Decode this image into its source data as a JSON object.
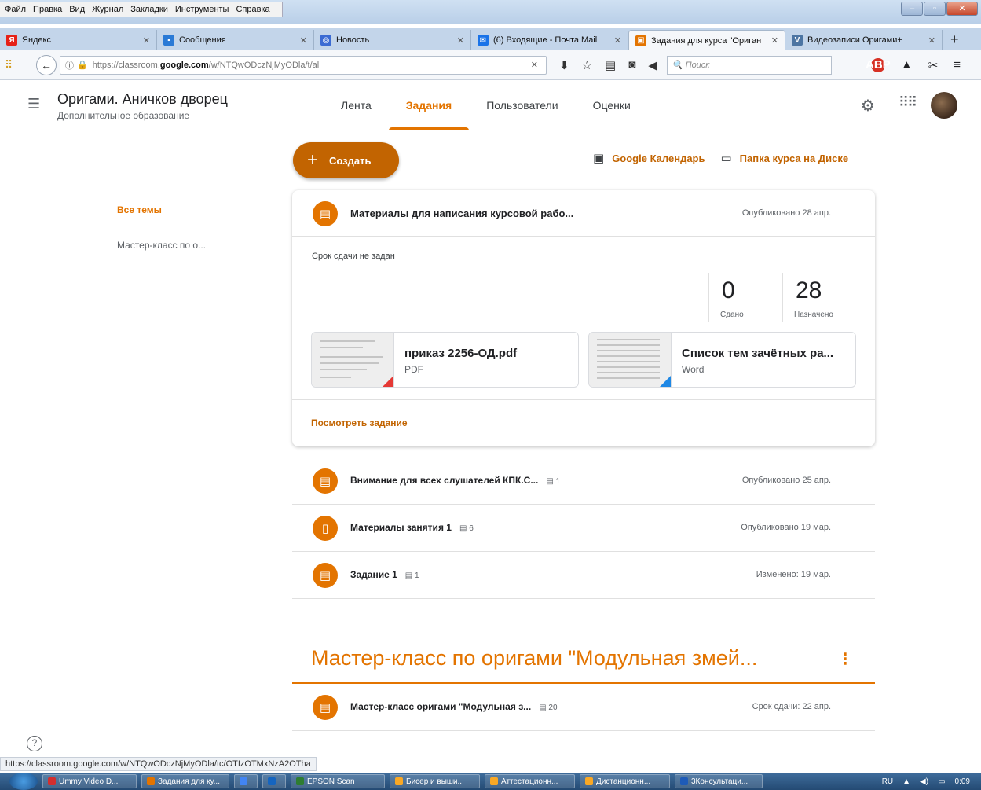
{
  "browser": {
    "menu": [
      "Файл",
      "Правка",
      "Вид",
      "Журнал",
      "Закладки",
      "Инструменты",
      "Справка"
    ],
    "tabs": [
      {
        "label": "Яндекс",
        "color": "#e62117",
        "glyph": "Я"
      },
      {
        "label": "Сообщения",
        "color": "#2a7ad6",
        "glyph": "▪"
      },
      {
        "label": "Новость",
        "color": "#3b6bd3",
        "glyph": "◎"
      },
      {
        "label": "(6) Входящие - Почта Mail",
        "color": "#1a73e8",
        "glyph": "✉"
      },
      {
        "label": "Задания для курса \"Ориган",
        "color": "#e37400",
        "glyph": "▣"
      },
      {
        "label": "Видеозаписи Оригами+",
        "color": "#4c75a3",
        "glyph": "V"
      }
    ],
    "url": {
      "prefix": "https://classroom.",
      "domain": "google.com",
      "path": "/w/NTQwODczNjMyODla/t/all"
    },
    "search_placeholder": "Поиск",
    "status_url": "https://classroom.google.com/w/NTQwODczNjMyODla/tc/OTIzOTMxNzA2OTha"
  },
  "classroom": {
    "course_title": "Оригами. Аничков дворец",
    "course_subtitle": "Дополнительное образование",
    "tabs": [
      "Лента",
      "Задания",
      "Пользователи",
      "Оценки"
    ],
    "create_label": "Создать",
    "calendar_link": "Google Календарь",
    "drive_link": "Папка курса на Диске",
    "sidebar": {
      "all_topics": "Все темы",
      "topic": "Мастер-класс по о..."
    },
    "expanded": {
      "title": "Материалы для написания курсовой рабо...",
      "date": "Опубликовано 28 апр.",
      "due": "Срок сдачи не задан",
      "turned_in": "0",
      "turned_in_label": "Сдано",
      "assigned": "28",
      "assigned_label": "Назначено",
      "attachments": [
        {
          "name": "приказ 2256-ОД.pdf",
          "type": "PDF",
          "corner_color": "#e53935"
        },
        {
          "name": "Список тем зачётных ра...",
          "type": "Word",
          "corner_color": "#1e88e5"
        }
      ],
      "view_label": "Посмотреть задание"
    },
    "items": [
      {
        "title": "Внимание для всех слушателей КПК.С...",
        "comments": "1",
        "date": "Опубликовано 25 апр.",
        "icon": "assignment-icon"
      },
      {
        "title": "Материалы занятия 1",
        "comments": "6",
        "date": "Опубликовано 19 мар.",
        "icon": "material-icon"
      },
      {
        "title": "Задание 1",
        "comments": "1",
        "date": "Изменено: 19 мар.",
        "icon": "assignment-icon"
      }
    ],
    "topic": {
      "title": "Мастер-класс по оригами \"Модульная змей...",
      "item": {
        "title": "Мастер-класс оригами \"Модульная з...",
        "comments": "20",
        "date": "Срок сдачи: 22 апр."
      }
    },
    "accent": "#e37400"
  },
  "taskbar": {
    "items": [
      {
        "label": "Ummy Video D...",
        "color": "#d32f2f"
      },
      {
        "label": "Задания для ку...",
        "color": "#e37400"
      },
      {
        "label": "",
        "color": "#4285f4"
      },
      {
        "label": "",
        "color": "#1565c0"
      },
      {
        "label": "EPSON Scan",
        "color": "#2e7d32"
      },
      {
        "label": "Бисер и выши...",
        "color": "#f9a825"
      },
      {
        "label": "Аттестационн...",
        "color": "#f9a825"
      },
      {
        "label": "Дистанционн...",
        "color": "#f9a825"
      },
      {
        "label": "3Консультаци...",
        "color": "#1e5bb8"
      }
    ],
    "lang": "RU",
    "time": "0:09"
  }
}
